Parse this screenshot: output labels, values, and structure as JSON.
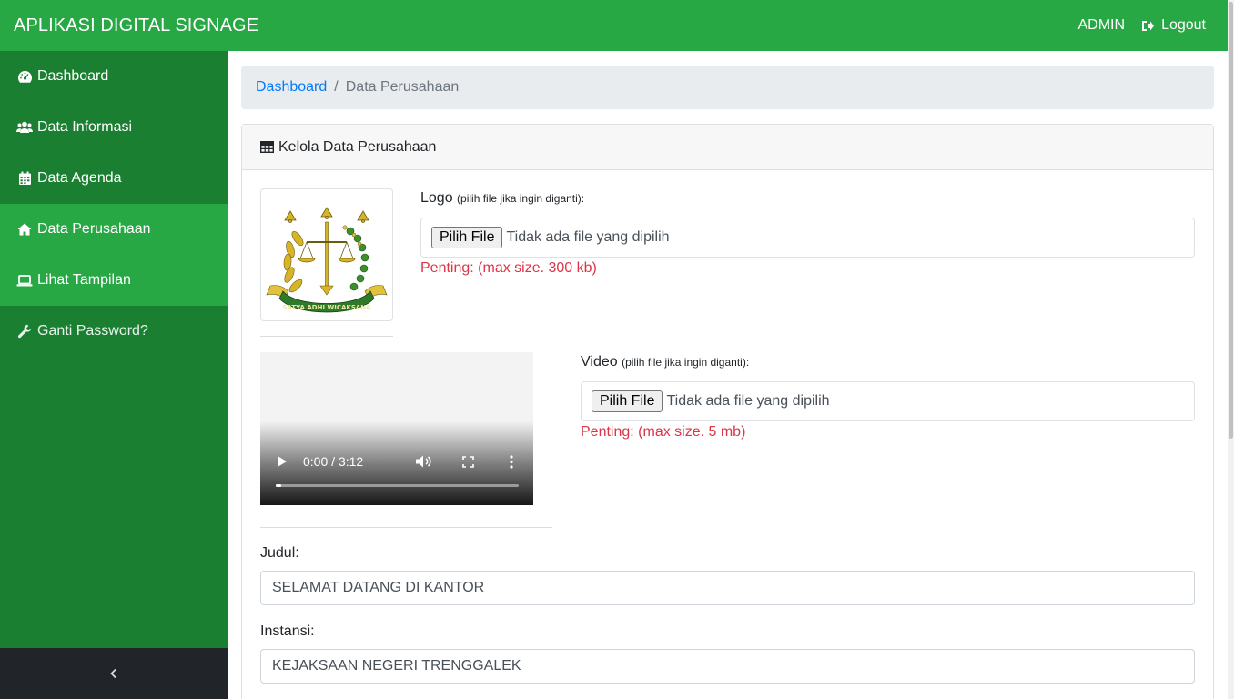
{
  "header": {
    "brand": "APLIKASI DIGITAL SIGNAGE",
    "user": "ADMIN",
    "logout_label": "Logout"
  },
  "sidebar": {
    "items": [
      {
        "label": "Dashboard",
        "icon": "dashboard-icon"
      },
      {
        "label": "Data Informasi",
        "icon": "users-icon"
      },
      {
        "label": "Data Agenda",
        "icon": "calendar-icon"
      },
      {
        "label": "Data Perusahaan",
        "icon": "home-icon",
        "active": true
      },
      {
        "label": "Lihat Tampilan",
        "icon": "laptop-icon"
      },
      {
        "label": "Ganti Password?",
        "icon": "wrench-icon"
      }
    ],
    "collapse_icon": "chevron-left-icon"
  },
  "breadcrumb": {
    "parent": "Dashboard",
    "separator": "/",
    "current": "Data Perusahaan"
  },
  "card": {
    "title": "Kelola Data Perusahaan",
    "logo": {
      "label": "Logo",
      "hint": "(pilih file jika ingin diganti):",
      "button": "Pilih File",
      "file_status": "Tidak ada file yang dipilih",
      "note": "Penting: (max size. 300 kb)",
      "seal_text": "SATYA ADHI WICAKSANA"
    },
    "video": {
      "label": "Video",
      "hint": "(pilih file jika ingin diganti):",
      "button": "Pilih File",
      "file_status": "Tidak ada file yang dipilih",
      "note": "Penting: (max size. 5 mb)",
      "time": "0:00 / 3:12"
    },
    "judul": {
      "label": "Judul:",
      "value": "SELAMAT DATANG DI KANTOR"
    },
    "instansi": {
      "label": "Instansi:",
      "value": "KEJAKSAAN NEGERI TRENGGALEK"
    }
  },
  "colors": {
    "primary": "#28a745",
    "sidebar": "#1a7f31",
    "danger": "#dc3545",
    "link": "#007bff"
  }
}
